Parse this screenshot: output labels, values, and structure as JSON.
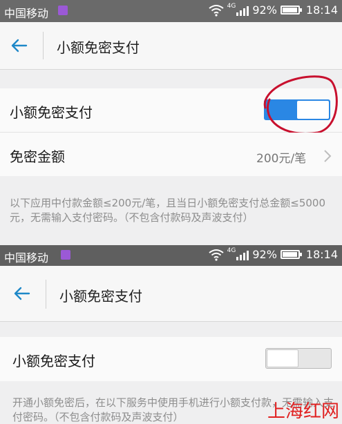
{
  "screen1": {
    "status": {
      "carrier": "中国移动",
      "network": "4G",
      "battery": "92%",
      "time": "18:14"
    },
    "header": {
      "title": "小额免密支付"
    },
    "toggle_row": {
      "label": "小额免密支付",
      "enabled": true
    },
    "amount_row": {
      "label": "免密金额",
      "value": "200元/笔"
    },
    "description": "以下应用中付款金额≤200元/笔，且当日小额免密支付总金额≤5000元，无需输入支付密码。（不包含付款码及声波支付）"
  },
  "screen2": {
    "status": {
      "carrier": "中国移动",
      "network": "4G",
      "battery": "92%",
      "time": "18:14"
    },
    "header": {
      "title": "小额免密支付"
    },
    "toggle_row": {
      "label": "小额免密支付",
      "enabled": false
    },
    "description": "开通小额免密后，在以下服务中使用手机进行小额支付款，无需输入支付密码。（不包含付款码及声波支付）"
  },
  "watermark": "上海红网",
  "colors": {
    "accent": "#2a87e4",
    "annotation_circle": "#c8102e",
    "watermark": "#e02020"
  },
  "icons": [
    "back-arrow-icon",
    "wifi-icon",
    "signal-icon",
    "battery-icon",
    "chevron-right-icon",
    "app-notification-icon"
  ]
}
